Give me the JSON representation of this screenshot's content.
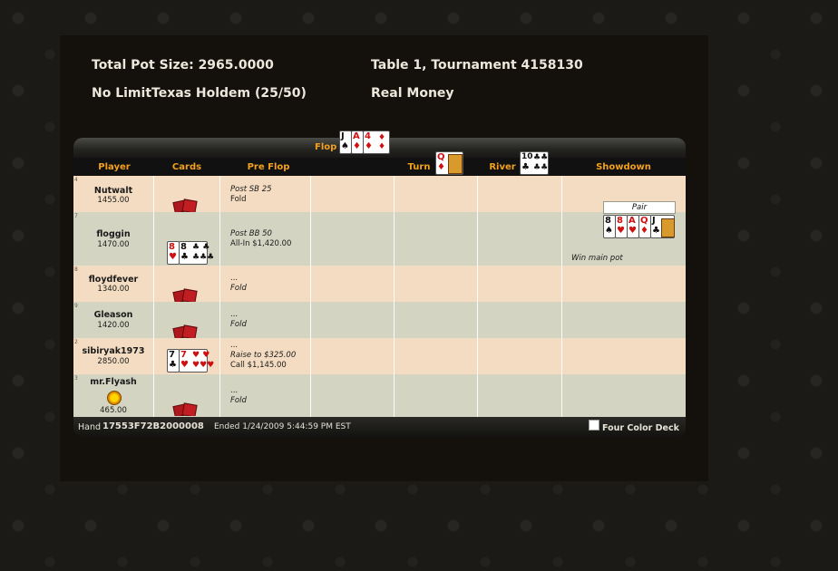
{
  "header": {
    "pot": "Total Pot Size: 2965.0000",
    "game": "No LimitTexas Holdem (25/50)",
    "table": "Table 1, Tournament 4158130",
    "money": "Real Money"
  },
  "streets": {
    "flop": "Flop",
    "turn": "Turn",
    "river": "River"
  },
  "columns": {
    "player": "Player",
    "cards": "Cards",
    "preflop": "Pre Flop",
    "showdown": "Showdown"
  },
  "board": {
    "flop": [
      {
        "rank": "J",
        "suit": "♠"
      },
      {
        "rank": "A",
        "suit": "♦"
      },
      {
        "rank": "4",
        "suit": "♦"
      }
    ],
    "turn": [
      {
        "rank": "Q",
        "suit": "♦"
      }
    ],
    "river": [
      {
        "rank": "10",
        "suit": "♣"
      }
    ]
  },
  "players": [
    {
      "seat": "4",
      "name": "Nutwalt",
      "chips": "1455.00",
      "a1": "Post SB 25",
      "a2": "Fold"
    },
    {
      "seat": "7",
      "name": "floggin",
      "chips": "1470.00",
      "a1": "Post BB 50",
      "a2": "All-In $1,420.00",
      "hole": [
        {
          "rank": "8",
          "suit": "♥"
        },
        {
          "rank": "8",
          "suit": "♣"
        }
      ]
    },
    {
      "seat": "8",
      "name": "floydfever",
      "chips": "1340.00",
      "a1": "...",
      "a2": "Fold"
    },
    {
      "seat": "9",
      "name": "Gleason",
      "chips": "1420.00",
      "a1": "...",
      "a2": "Fold"
    },
    {
      "seat": "2",
      "name": "sibiryak1973",
      "chips": "2850.00",
      "a1": "...",
      "a2": "Raise to $325.00",
      "a3": "Call $1,145.00",
      "hole": [
        {
          "rank": "7",
          "suit": "♣"
        },
        {
          "rank": "7",
          "suit": "♥"
        }
      ]
    },
    {
      "seat": "3",
      "name": "mr.Flyash",
      "chips": "465.00",
      "a1": "...",
      "a2": "Fold"
    }
  ],
  "showdown": {
    "cards": [
      {
        "rank": "8",
        "suit": "♠"
      },
      {
        "rank": "8",
        "suit": "♥"
      },
      {
        "rank": "A",
        "suit": "♥"
      },
      {
        "rank": "Q",
        "suit": "♦"
      },
      {
        "rank": "J",
        "suit": "♣"
      }
    ],
    "hand": "Pair",
    "result": "Win main pot"
  },
  "footer": {
    "hand_label": "Hand",
    "hand_id": "17553F72B2000008",
    "ended": "Ended 1/24/2009 5:44:59 PM EST",
    "four_color": "Four Color Deck"
  },
  "colors": {
    "accent": "#f3a11c",
    "row_light": "#f3dcc1",
    "row_dark": "#d3d5c2"
  }
}
